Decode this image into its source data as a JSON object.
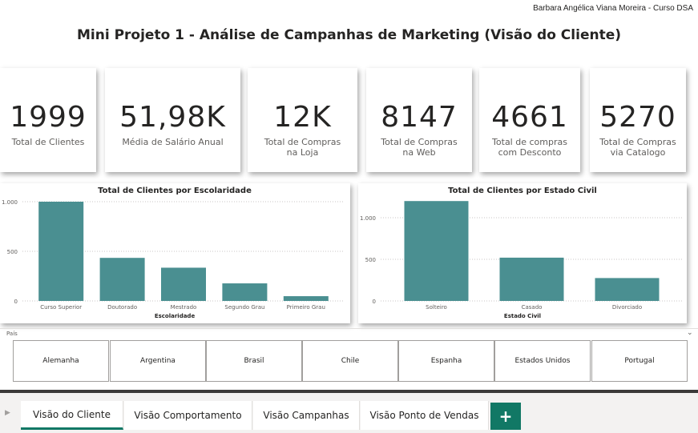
{
  "author": "Barbara Angélica Viana Moreira - Curso DSA",
  "title": "Mini Projeto 1 - Análise de Campanhas de Marketing (Visão do Cliente)",
  "cards": [
    {
      "value": "1999",
      "label": "Total de Clientes"
    },
    {
      "value": "51,98K",
      "label": "Média de Salário Anual"
    },
    {
      "value": "12K",
      "label": "Total de Compras na Loja"
    },
    {
      "value": "8147",
      "label": "Total de Compras na Web"
    },
    {
      "value": "4661",
      "label": "Total de compras com Desconto"
    },
    {
      "value": "5270",
      "label": "Total de Compras via Catalogo"
    }
  ],
  "chart_data": [
    {
      "type": "bar",
      "title": "Total de Clientes por Escolaridade",
      "xlabel": "Escolaridade",
      "ylabel": "",
      "categories": [
        "Curso Superior",
        "Doutorado",
        "Mestrado",
        "Segundo Grau",
        "Primeiro Grau"
      ],
      "values": [
        1000,
        434,
        335,
        177,
        48
      ],
      "yticks": [
        "0",
        "500",
        "1.000"
      ],
      "ylim": [
        0,
        1000
      ],
      "color": "#4a8f91"
    },
    {
      "type": "bar",
      "title": "Total de Clientes por Estado Civil",
      "xlabel": "Estado Civil",
      "ylabel": "",
      "categories": [
        "Solteiro",
        "Casado",
        "Divorciado"
      ],
      "values": [
        1200,
        520,
        275
      ],
      "yticks": [
        "0",
        "500",
        "1.000"
      ],
      "ylim": [
        0,
        1000
      ],
      "color": "#4a8f91"
    }
  ],
  "slicer": {
    "header": "País",
    "options": [
      "Alemanha",
      "Argentina",
      "Brasil",
      "Chile",
      "Espanha",
      "Estados Unidos",
      "Portugal"
    ]
  },
  "tabs": [
    {
      "label": "Visão do Cliente",
      "active": true
    },
    {
      "label": "Visão Comportamento",
      "active": false
    },
    {
      "label": "Visão Campanhas",
      "active": false
    },
    {
      "label": "Visão Ponto de Vendas",
      "active": false
    }
  ],
  "add_tab_label": "+",
  "icons": {
    "nav": "caret-right-icon",
    "chevron": "chevron-down-icon"
  },
  "colors": {
    "bar": "#4a8f91",
    "accent": "#117865"
  }
}
